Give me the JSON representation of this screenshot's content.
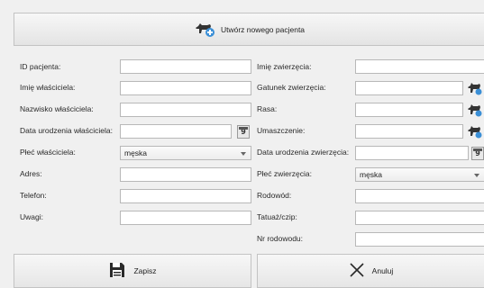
{
  "header": {
    "new_patient_label": "Utwórz nowego pacjenta"
  },
  "owner": {
    "fields": [
      {
        "label": "ID pacjenta:",
        "value": ""
      },
      {
        "label": "Imię właściciela:",
        "value": ""
      },
      {
        "label": "Nazwisko właściciela:",
        "value": ""
      },
      {
        "label": "Data urodzenia właściciela:",
        "value": ""
      },
      {
        "label": "Płeć właściciela:",
        "value": "męska"
      },
      {
        "label": "Adres:",
        "value": ""
      },
      {
        "label": "Telefon:",
        "value": ""
      },
      {
        "label": "Uwagi:",
        "value": ""
      }
    ],
    "date_button_label": "9"
  },
  "animal": {
    "fields": [
      {
        "label": "Imię zwierzęcia:",
        "value": ""
      },
      {
        "label": "Gatunek zwierzęcia:",
        "value": ""
      },
      {
        "label": "Rasa:",
        "value": ""
      },
      {
        "label": "Umaszczenie:",
        "value": ""
      },
      {
        "label": "Data urodzenia zwierzęcia:",
        "value": ""
      },
      {
        "label": "Płeć zwierzęcia:",
        "value": "męska"
      },
      {
        "label": "Rodowód:",
        "value": ""
      },
      {
        "label": "Tatuaż/czip:",
        "value": ""
      },
      {
        "label": "Nr rodowodu:",
        "value": ""
      }
    ],
    "date_button_label": "9"
  },
  "footer": {
    "save_label": "Zapisz",
    "cancel_label": "Anuluj"
  },
  "icons": {
    "new_patient": "dog-plus-icon",
    "save": "save-icon",
    "cancel": "close-icon",
    "dictionary": "dog-icon",
    "calendar": "calendar-icon"
  }
}
